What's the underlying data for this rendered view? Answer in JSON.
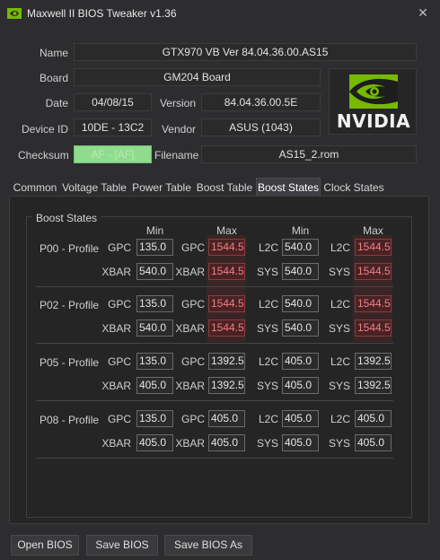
{
  "window": {
    "title": "Maxwell II BIOS Tweaker v1.36",
    "close": "✕"
  },
  "info": {
    "name_label": "Name",
    "name_value": "GTX970 VB Ver 84.04.36.00.AS15",
    "board_label": "Board",
    "board_value": "GM204 Board",
    "date_label": "Date",
    "date_value": "04/08/15",
    "version_label": "Version",
    "version_value": "84.04.36.00.5E",
    "device_label": "Device ID",
    "device_value": "10DE - 13C2",
    "vendor_label": "Vendor",
    "vendor_value": "ASUS (1043)",
    "checksum_label": "Checksum",
    "checksum_value": "AF - [AF]",
    "filename_label": "Filename",
    "filename_value": "AS15_2.rom"
  },
  "logo": {
    "text": "NVIDIA",
    "color": "#76b900"
  },
  "tabs": [
    "Common",
    "Voltage Table",
    "Power Table",
    "Boost Table",
    "Boost States",
    "Clock States"
  ],
  "active_tab": "Boost States",
  "boost": {
    "group_title": "Boost States",
    "headers": [
      "Min",
      "Max",
      "Min",
      "Max"
    ],
    "profiles": [
      {
        "label": "P00 - Profile",
        "row1": {
          "l1": "GPC",
          "v1": "135.0",
          "l2": "GPC",
          "v2": "1544.5",
          "l3": "L2C",
          "v3": "540.0",
          "l4": "L2C",
          "v4": "1544.5"
        },
        "row2": {
          "l1": "XBAR",
          "v1": "540.0",
          "l2": "XBAR",
          "v2": "1544.5",
          "l3": "SYS",
          "v3": "540.0",
          "l4": "SYS",
          "v4": "1544.5"
        }
      },
      {
        "label": "P02 - Profile",
        "row1": {
          "l1": "GPC",
          "v1": "135.0",
          "l2": "GPC",
          "v2": "1544.5",
          "l3": "L2C",
          "v3": "540.0",
          "l4": "L2C",
          "v4": "1544.5"
        },
        "row2": {
          "l1": "XBAR",
          "v1": "540.0",
          "l2": "XBAR",
          "v2": "1544.5",
          "l3": "SYS",
          "v3": "540.0",
          "l4": "SYS",
          "v4": "1544.5"
        }
      },
      {
        "label": "P05 - Profile",
        "row1": {
          "l1": "GPC",
          "v1": "135.0",
          "l2": "GPC",
          "v2": "1392.5",
          "l3": "L2C",
          "v3": "405.0",
          "l4": "L2C",
          "v4": "1392.5"
        },
        "row2": {
          "l1": "XBAR",
          "v1": "405.0",
          "l2": "XBAR",
          "v2": "1392.5",
          "l3": "SYS",
          "v3": "405.0",
          "l4": "SYS",
          "v4": "1392.5"
        }
      },
      {
        "label": "P08 - Profile",
        "row1": {
          "l1": "GPC",
          "v1": "135.0",
          "l2": "GPC",
          "v2": "405.0",
          "l3": "L2C",
          "v3": "405.0",
          "l4": "L2C",
          "v4": "405.0"
        },
        "row2": {
          "l1": "XBAR",
          "v1": "405.0",
          "l2": "XBAR",
          "v2": "405.0",
          "l3": "SYS",
          "v3": "405.0",
          "l4": "SYS",
          "v4": "405.0"
        }
      }
    ]
  },
  "buttons": {
    "open": "Open BIOS",
    "save": "Save BIOS",
    "save_as": "Save BIOS As"
  }
}
